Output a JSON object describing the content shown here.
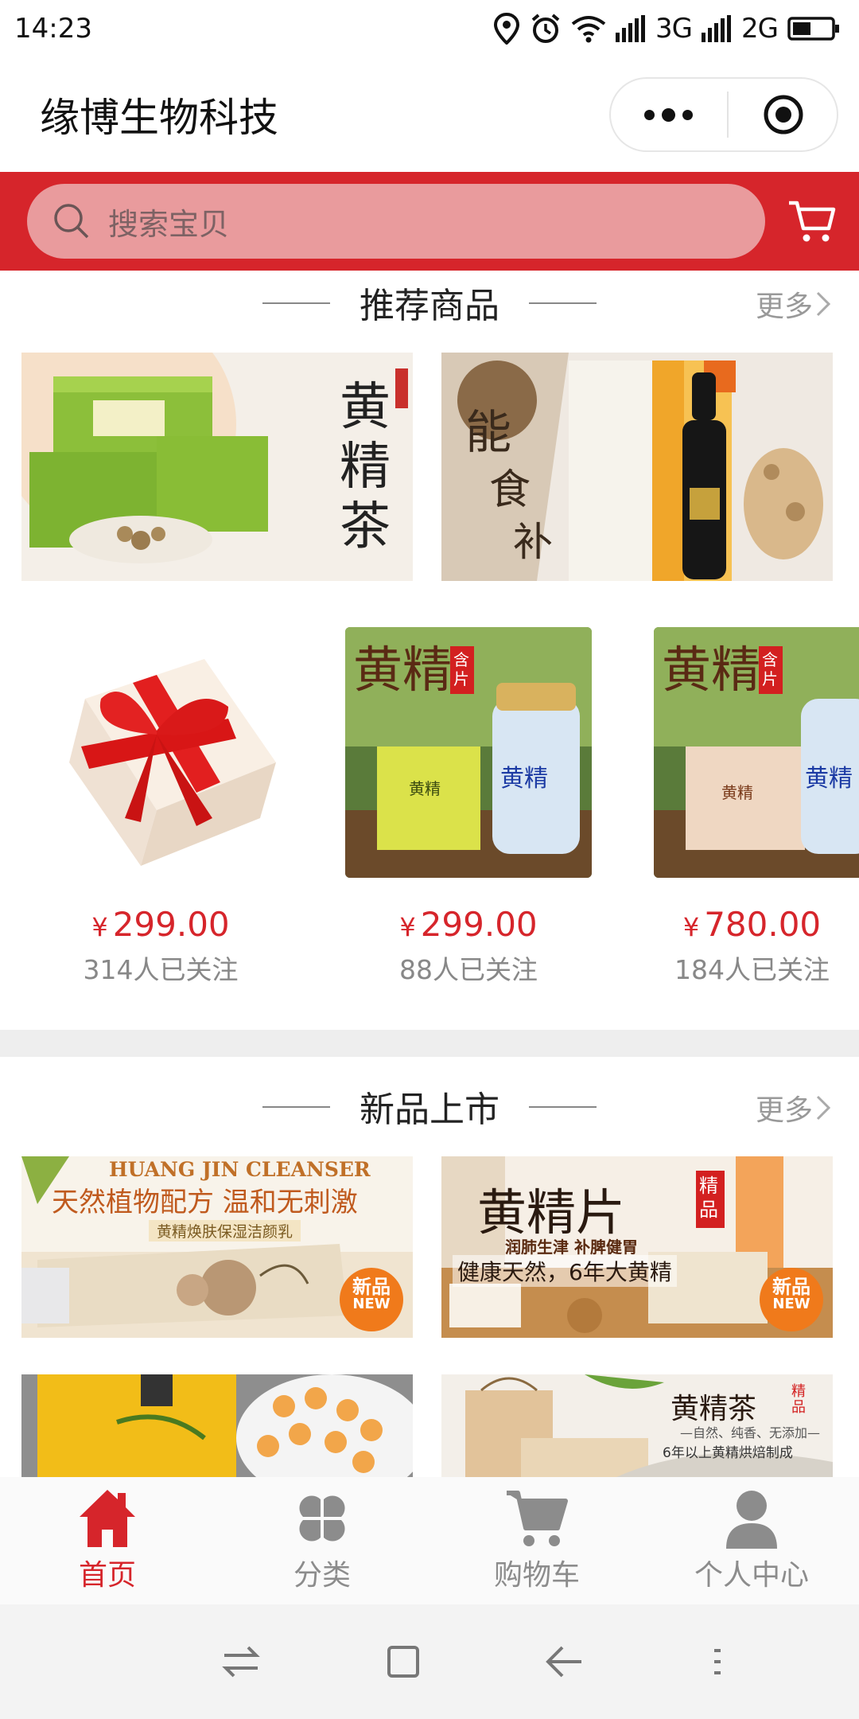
{
  "status_bar": {
    "time": "14:23",
    "network_1": "3G",
    "network_2": "2G"
  },
  "header": {
    "title": "缘博生物科技"
  },
  "search": {
    "placeholder": "搜索宝贝"
  },
  "recommended": {
    "title": "推荐商品",
    "more": "更多",
    "banners": [
      {
        "text": "黄精茶"
      },
      {
        "text": "能食补想象"
      }
    ],
    "products": [
      {
        "currency": "¥",
        "price": "299.00",
        "followers": "314人已关注"
      },
      {
        "currency": "¥",
        "price": "299.00",
        "followers": "88人已关注"
      },
      {
        "currency": "¥",
        "price": "780.00",
        "followers": "184人已关注"
      }
    ]
  },
  "new_arrivals": {
    "title": "新品上市",
    "more": "更多",
    "banners": [
      {
        "headline_en": "HUANG JIN CLEANSER",
        "headline": "天然植物配方 温和无刺激",
        "sub": "黄精焕肤保湿洁颜乳",
        "badge": "新品",
        "badge_en": "NEW"
      },
      {
        "headline": "黄精片",
        "tag": "精品",
        "sub": "润肺生津  补脾健胃",
        "line": "健康天然，6年大黄精",
        "badge": "新品",
        "badge_en": "NEW"
      },
      {
        "text": ""
      },
      {
        "headline": "黄精茶",
        "tag": "精品",
        "sub": "—自然、纯香、无添加—",
        "line": "6年以上黄精烘焙制成"
      }
    ]
  },
  "tabbar": {
    "items": [
      {
        "label": "首页",
        "icon": "home-icon",
        "active": true
      },
      {
        "label": "分类",
        "icon": "category-icon",
        "active": false
      },
      {
        "label": "购物车",
        "icon": "cart-icon",
        "active": false
      },
      {
        "label": "个人中心",
        "icon": "person-icon",
        "active": false
      }
    ]
  },
  "colors": {
    "brand_red": "#d6252b",
    "search_bg": "#e99b9d",
    "muted": "#888888"
  }
}
